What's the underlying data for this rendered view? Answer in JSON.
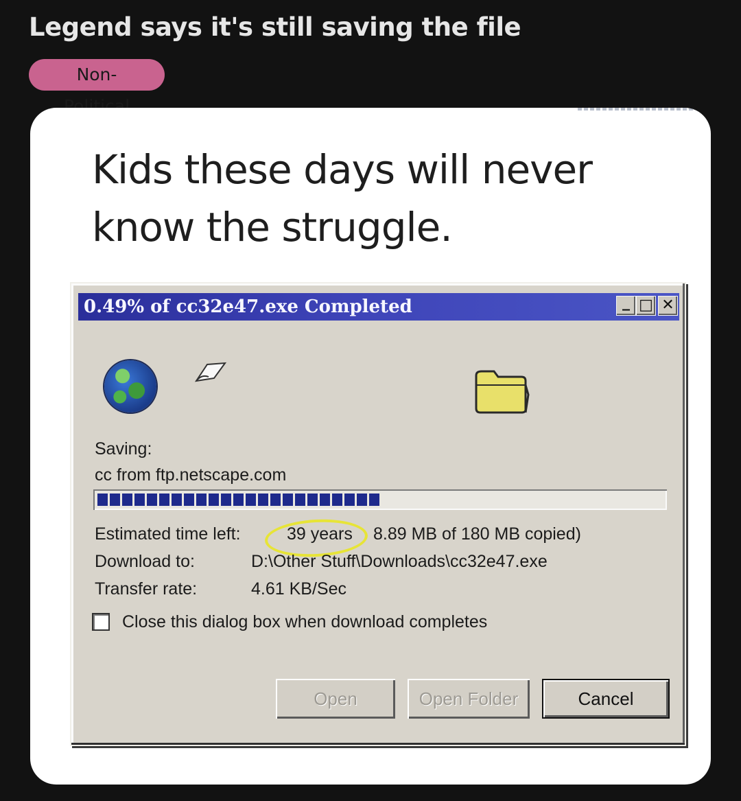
{
  "post": {
    "title": "Legend says it's still saving the file",
    "flair": "Non-Political"
  },
  "meme": {
    "caption": "Kids these days will never know the struggle."
  },
  "dialog": {
    "title": "0.49% of cc32e47.exe Completed",
    "window_buttons": {
      "minimize": "_",
      "maximize": "□",
      "close": "✕"
    },
    "icons": {
      "left": "globe-icon",
      "middle": "paper-icon",
      "right": "folder-icon"
    },
    "saving_label": "Saving:",
    "saving_source": "cc from ftp.netscape.com",
    "progress": 0.49,
    "estimated_label": "Estimated time left:",
    "estimated_value": "39 years",
    "copied_value": "8.89 MB of 180 MB copied)",
    "download_to_label": "Download to:",
    "download_to_value": "D:\\Other Stuff\\Downloads\\cc32e47.exe",
    "transfer_rate_label": "Transfer rate:",
    "transfer_rate_value": "4.61 KB/Sec",
    "close_checkbox_label": "Close this dialog box when download completes",
    "close_checkbox_checked": false,
    "buttons": {
      "open": "Open",
      "open_folder": "Open Folder",
      "cancel": "Cancel"
    }
  },
  "colors": {
    "background": "#121212",
    "flair": "#c9638f",
    "titlebar": "#2a2e9a",
    "highlight": "#e7e436"
  }
}
